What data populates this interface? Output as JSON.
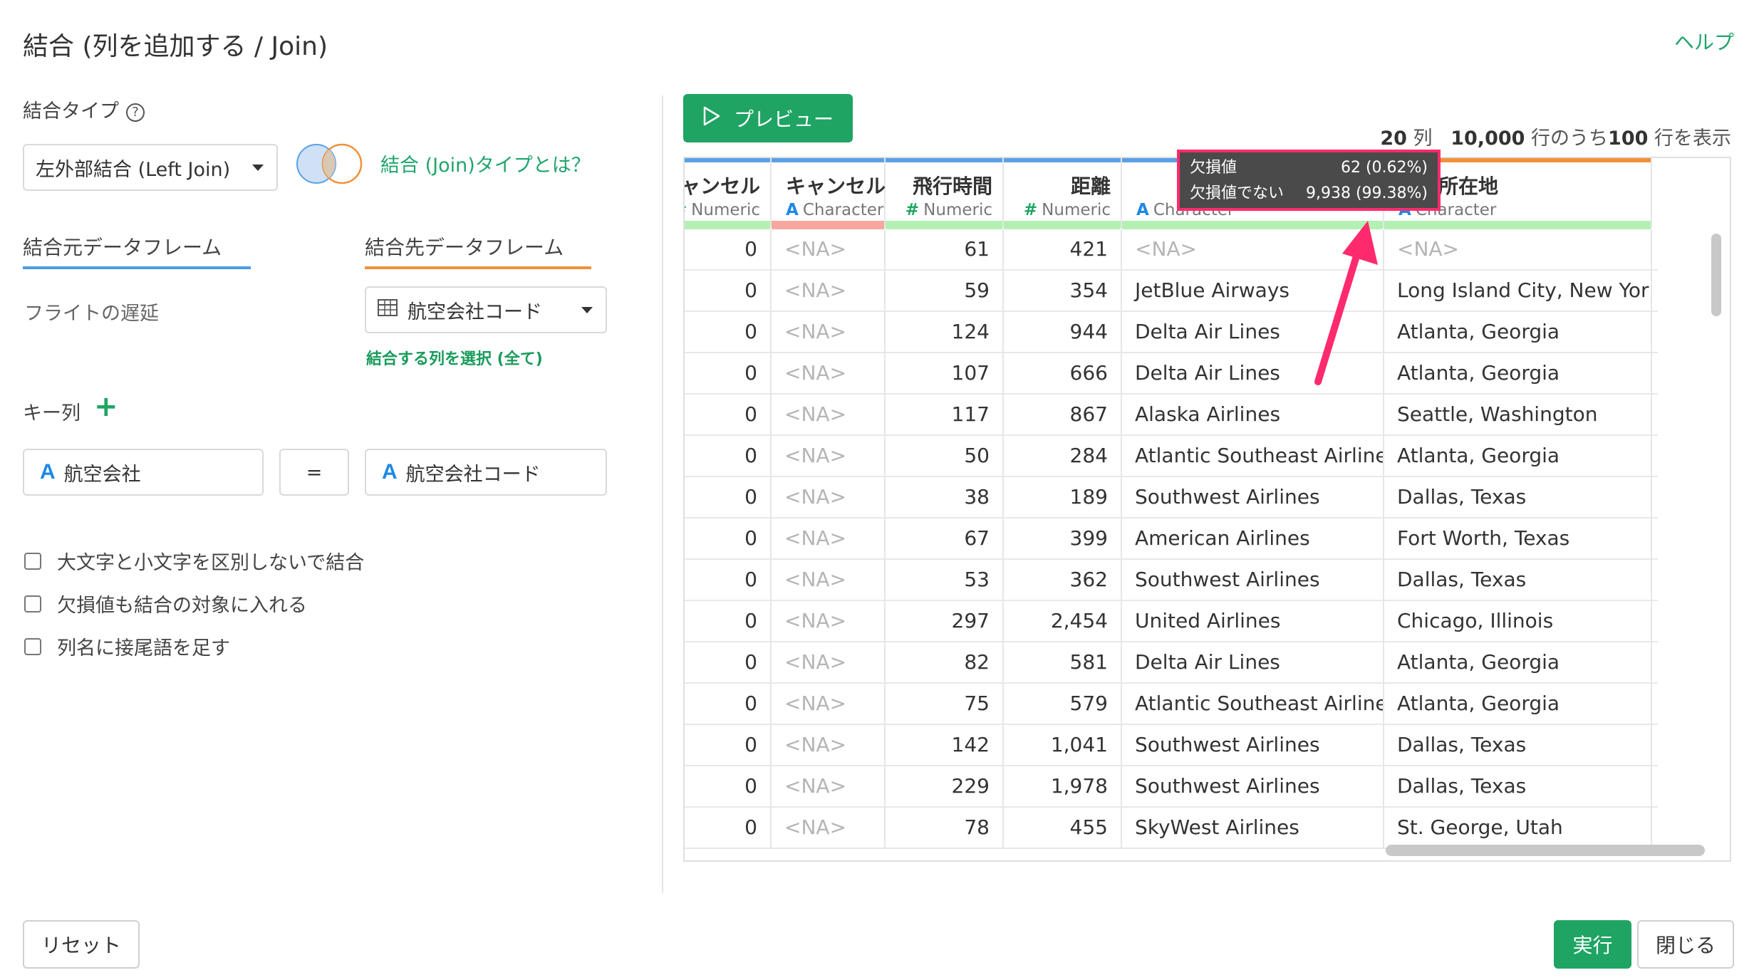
{
  "dialog": {
    "title": "結合 (列を追加する / Join)",
    "help_label": "ヘルプ"
  },
  "left": {
    "join_type_label": "結合タイプ",
    "join_type_help": "?",
    "join_type_value": "左外部結合 (Left Join)",
    "join_type_link": "結合 (Join)タイプとは？",
    "source_tab": "結合元データフレーム",
    "target_tab": "結合先データフレーム",
    "source_name": "フライトの遅延",
    "target_value": "航空会社コード",
    "select_columns_link": "結合する列を選択 (全て)",
    "key_label": "キー列",
    "key_add": "+",
    "key_left": "航空会社",
    "key_equals": "=",
    "key_right": "航空会社コード",
    "type_icon": "A",
    "checkboxes": [
      "大文字と小文字を区別しないで結合",
      "欠損値も結合の対象に入れる",
      "列名に接尾語を足す"
    ]
  },
  "preview": {
    "button_label": "プレビュー",
    "info": {
      "cols": "20",
      "cols_unit": "列",
      "total": "10,000",
      "total_unit": "行のうち",
      "shown": "100",
      "shown_unit": "行を表示"
    }
  },
  "table": {
    "columns": [
      {
        "name": "ャンセル",
        "type": "Numeric",
        "icon": "#",
        "top_color": "#5aa1e6",
        "bar_color": "#b4f0b4"
      },
      {
        "name": "キャンセル理由",
        "type": "Character",
        "icon": "A",
        "top_color": "#5aa1e6",
        "bar_color": "#f7a7a0"
      },
      {
        "name": "飛行時間",
        "type": "Numeric",
        "icon": "#",
        "top_color": "#5aa1e6",
        "bar_color": "#b4f0b4"
      },
      {
        "name": "距離",
        "type": "Numeric",
        "icon": "#",
        "top_color": "#5aa1e6",
        "bar_color": "#b4f0b4"
      },
      {
        "name": "",
        "type": "Character",
        "icon": "A",
        "top_color": "#5aa1e6",
        "bar_color": "#b4f0b4"
      },
      {
        "name": "本社所在地",
        "type": "Character",
        "icon": "A",
        "top_color": "#f0913a",
        "bar_color": "#b4f0b4"
      }
    ],
    "rows": [
      [
        "0",
        "<NA>",
        "61",
        "421",
        "<NA>",
        "<NA>"
      ],
      [
        "0",
        "<NA>",
        "59",
        "354",
        "JetBlue Airways",
        "Long Island City, New York"
      ],
      [
        "0",
        "<NA>",
        "124",
        "944",
        "Delta Air Lines",
        "Atlanta, Georgia"
      ],
      [
        "0",
        "<NA>",
        "107",
        "666",
        "Delta Air Lines",
        "Atlanta, Georgia"
      ],
      [
        "0",
        "<NA>",
        "117",
        "867",
        "Alaska Airlines",
        "Seattle, Washington"
      ],
      [
        "0",
        "<NA>",
        "50",
        "284",
        "Atlantic Southeast Airlines",
        "Atlanta, Georgia"
      ],
      [
        "0",
        "<NA>",
        "38",
        "189",
        "Southwest Airlines",
        "Dallas, Texas"
      ],
      [
        "0",
        "<NA>",
        "67",
        "399",
        "American Airlines",
        "Fort Worth, Texas"
      ],
      [
        "0",
        "<NA>",
        "53",
        "362",
        "Southwest Airlines",
        "Dallas, Texas"
      ],
      [
        "0",
        "<NA>",
        "297",
        "2,454",
        "United Airlines",
        "Chicago, Illinois"
      ],
      [
        "0",
        "<NA>",
        "82",
        "581",
        "Delta Air Lines",
        "Atlanta, Georgia"
      ],
      [
        "0",
        "<NA>",
        "75",
        "579",
        "Atlantic Southeast Airlines",
        "Atlanta, Georgia"
      ],
      [
        "0",
        "<NA>",
        "142",
        "1,041",
        "Southwest Airlines",
        "Dallas, Texas"
      ],
      [
        "0",
        "<NA>",
        "229",
        "1,978",
        "Southwest Airlines",
        "Dallas, Texas"
      ],
      [
        "0",
        "<NA>",
        "78",
        "455",
        "SkyWest Airlines",
        "St. George, Utah"
      ]
    ],
    "tooltip": {
      "missing_label": "欠損値",
      "missing_value": "62 (0.62%)",
      "present_label": "欠損値でない",
      "present_value": "9,938 (99.38%)"
    }
  },
  "footer": {
    "reset": "リセット",
    "run": "実行",
    "close": "閉じる"
  },
  "colors": {
    "accent_green": "#1fa463",
    "highlight_pink": "#ff2a6d",
    "blue_tab": "#4a9be8",
    "orange_tab": "#f0913a"
  }
}
